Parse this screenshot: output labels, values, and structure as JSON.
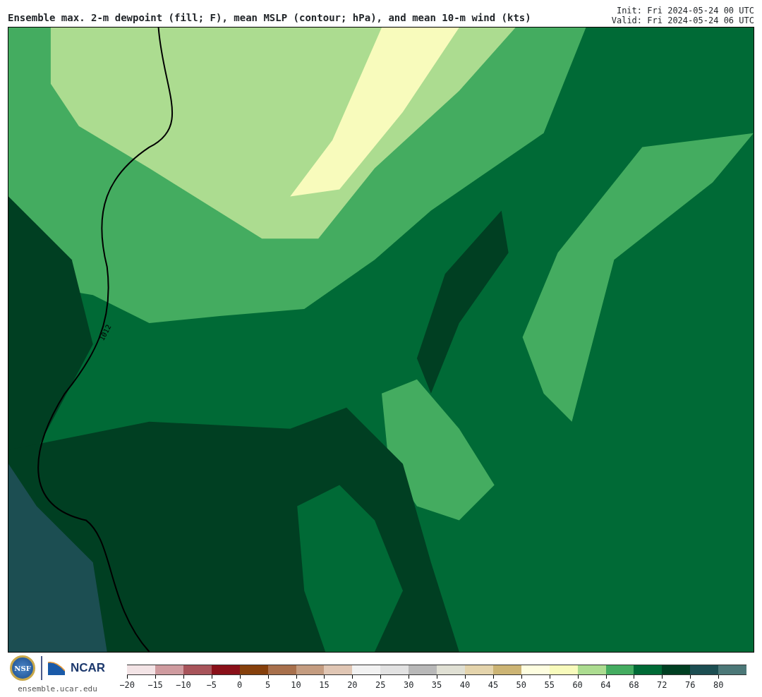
{
  "title": "Ensemble max. 2-m dewpoint (fill; F), mean MSLP (contour; hPa), and mean 10-m wind (kts)",
  "init": "Init: Fri 2024-05-24 00 UTC",
  "valid": "Valid: Fri 2024-05-24 06 UTC",
  "map": {
    "contour_label": "1012"
  },
  "footer": {
    "logo_text": "NSF",
    "brand": "NCAR",
    "url": "ensemble.ucar.edu"
  },
  "colorbar": {
    "bins": [
      {
        "color": "#f3e4e6",
        "tick": "−20"
      },
      {
        "color": "#cf9b9f",
        "tick": "−15"
      },
      {
        "color": "#a8545a",
        "tick": "−10"
      },
      {
        "color": "#8a1019",
        "tick": "−5"
      },
      {
        "color": "#86400c",
        "tick": "0"
      },
      {
        "color": "#a8704c",
        "tick": "5"
      },
      {
        "color": "#c49c80",
        "tick": "10"
      },
      {
        "color": "#e0c6b4",
        "tick": "15"
      },
      {
        "color": "#f2f2f2",
        "tick": "20"
      },
      {
        "color": "#e2e2e2",
        "tick": "25"
      },
      {
        "color": "#b8b8b8",
        "tick": "30"
      },
      {
        "color": "#e0e0d4",
        "tick": "35"
      },
      {
        "color": "#e4d4ac",
        "tick": "40"
      },
      {
        "color": "#ccb474",
        "tick": "45"
      },
      {
        "color": "#fefee0",
        "tick": "50"
      },
      {
        "color": "#f8fbbc",
        "tick": "55"
      },
      {
        "color": "#acdc90",
        "tick": "60"
      },
      {
        "color": "#44ac60",
        "tick": "64"
      },
      {
        "color": "#006a36",
        "tick": "68"
      },
      {
        "color": "#003f22",
        "tick": "72"
      },
      {
        "color": "#1c4e52",
        "tick": "76"
      },
      {
        "color": "#4c7878",
        "tick": "80"
      }
    ]
  }
}
